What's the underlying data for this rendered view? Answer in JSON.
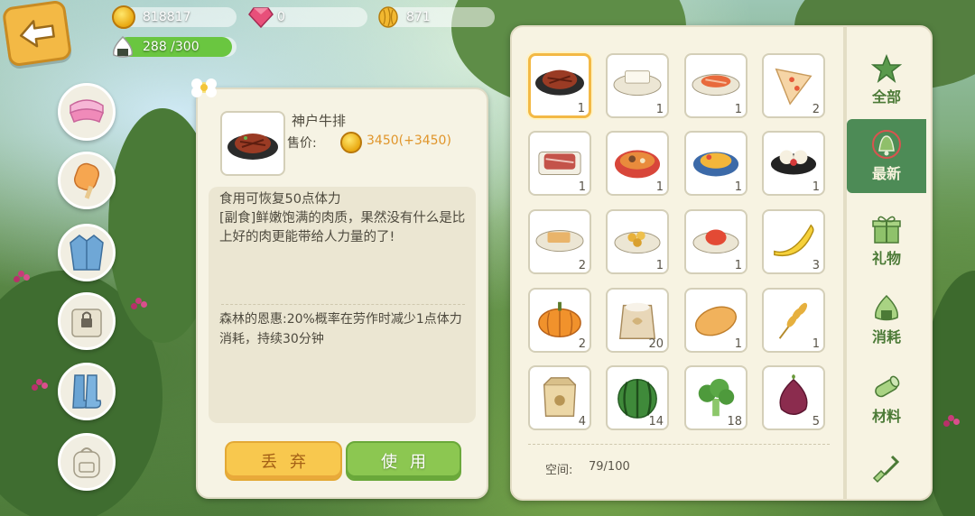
{
  "currency": {
    "gold": "818817",
    "gems": "0",
    "seeds": "871",
    "energy": "288 /300",
    "energy_ratio": 0.96
  },
  "colors": {
    "gold": "#e9a912",
    "price_highlight": "#e0952a",
    "active_tab": "#4d8b56",
    "discard_button": "#f8c84e",
    "use_button": "#8cc751"
  },
  "left_categories": [
    {
      "icon": "visor-icon"
    },
    {
      "icon": "popsicle-icon"
    },
    {
      "icon": "jacket-icon"
    },
    {
      "icon": "locked-bag-icon"
    },
    {
      "icon": "boots-icon"
    },
    {
      "icon": "backpack-icon"
    }
  ],
  "detail": {
    "name": "神户牛排",
    "price_label": "售价:",
    "price_value": "3450(+3450)",
    "description": "食用可恢复50点体力\n[副食]鲜嫩饱满的肉质，果然没有什么是比上好的肉更能带给人力量的了!",
    "effect": "森林的恩惠:20%概率在劳作时减少1点体力消耗，持续30分钟",
    "discard_label": "丢弃",
    "use_label": "使用"
  },
  "tabs": [
    {
      "label": "全部",
      "icon": "star-icon"
    },
    {
      "label": "最新",
      "icon": "bell-icon"
    },
    {
      "label": "礼物",
      "icon": "gift-icon"
    },
    {
      "label": "消耗",
      "icon": "rice-ball-icon"
    },
    {
      "label": "材料",
      "icon": "log-icon"
    },
    {
      "label": "",
      "icon": "shovel-icon"
    }
  ],
  "inventory": {
    "space_label": "空间:",
    "space_value": "79/100",
    "items": [
      {
        "icon": "steak-icon",
        "count": "1"
      },
      {
        "icon": "tofu-icon",
        "count": "1"
      },
      {
        "icon": "fish-dish-icon",
        "count": "1"
      },
      {
        "icon": "pizza-slice-icon",
        "count": "2"
      },
      {
        "icon": "raw-meat-icon",
        "count": "1"
      },
      {
        "icon": "hotpot-icon",
        "count": "1"
      },
      {
        "icon": "fruit-platter-icon",
        "count": "1"
      },
      {
        "icon": "dessert-plate-icon",
        "count": "1"
      },
      {
        "icon": "toast-plate-icon",
        "count": "2"
      },
      {
        "icon": "potato-dish-icon",
        "count": "1"
      },
      {
        "icon": "tomato-dish-icon",
        "count": "1"
      },
      {
        "icon": "banana-icon",
        "count": "3"
      },
      {
        "icon": "pumpkin-icon",
        "count": "2"
      },
      {
        "icon": "flour-sack-icon",
        "count": "20"
      },
      {
        "icon": "potato-icon",
        "count": "1"
      },
      {
        "icon": "wheat-icon",
        "count": "1"
      },
      {
        "icon": "seed-bag-icon",
        "count": "4"
      },
      {
        "icon": "watermelon-icon",
        "count": "14"
      },
      {
        "icon": "broccoli-icon",
        "count": "18"
      },
      {
        "icon": "onion-icon",
        "count": "5"
      }
    ]
  }
}
